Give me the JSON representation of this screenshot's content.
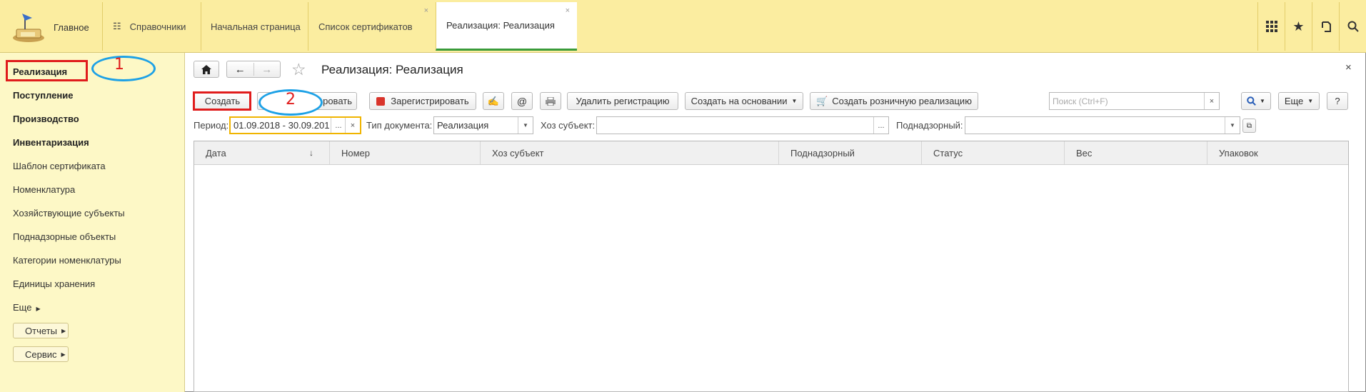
{
  "topbar": {
    "home_label": "Главное",
    "tabs": [
      {
        "label": "Справочники"
      },
      {
        "label": "Начальная страница"
      },
      {
        "label": "Список сертификатов",
        "close": "×"
      },
      {
        "label": "Реализация: Реализация",
        "close": "×"
      }
    ],
    "right_icons": [
      "apps-grid-icon",
      "star-icon",
      "history-icon",
      "search-icon"
    ]
  },
  "sidebar": {
    "items": [
      {
        "label": "Реализация"
      },
      {
        "label": "Поступление"
      },
      {
        "label": "Производство"
      },
      {
        "label": "Инвентаризация"
      },
      {
        "label": "Шаблон сертификата"
      },
      {
        "label": "Номенклатура"
      },
      {
        "label": "Хозяйствующие субъекты"
      },
      {
        "label": "Поднадзорные объекты"
      },
      {
        "label": "Категории номенклатуры"
      },
      {
        "label": "Единицы хранения"
      },
      {
        "label": "Еще"
      }
    ],
    "buttons": [
      {
        "label": "Отчеты"
      },
      {
        "label": "Сервис"
      }
    ]
  },
  "annotations": {
    "one": "1",
    "two": "2",
    "accent_red": "#e01c1c",
    "accent_blue": "#1da1e6"
  },
  "form": {
    "title": "Реализация: Реализация",
    "close": "×",
    "toolbar": {
      "create": "Создать",
      "copy_partial": "ровать",
      "register": "Зарегистрировать",
      "at": "@",
      "delete_registration": "Удалить регистрацию",
      "create_based_on": "Создать на основании",
      "create_retail": "Создать розничную реализацию",
      "search_placeholder": "Поиск (Ctrl+F)",
      "search_clear": "×",
      "more": "Еще",
      "help": "?"
    },
    "filters": {
      "period_label": "Период:",
      "period_value": "01.09.2018 - 30.09.201",
      "period_dots": "...",
      "period_clear": "×",
      "doctype_label": "Тип документа:",
      "doctype_value": "Реализация",
      "subject_label": "Хоз субъект:",
      "subject_dots": "...",
      "supervised_label": "Поднадзорный:"
    },
    "table": {
      "columns": [
        "Дата",
        "Номер",
        "Хоз субъект",
        "Поднадзорный",
        "Статус",
        "Вес",
        "Упаковок"
      ],
      "sort_indicator": "↓",
      "rows": []
    }
  }
}
